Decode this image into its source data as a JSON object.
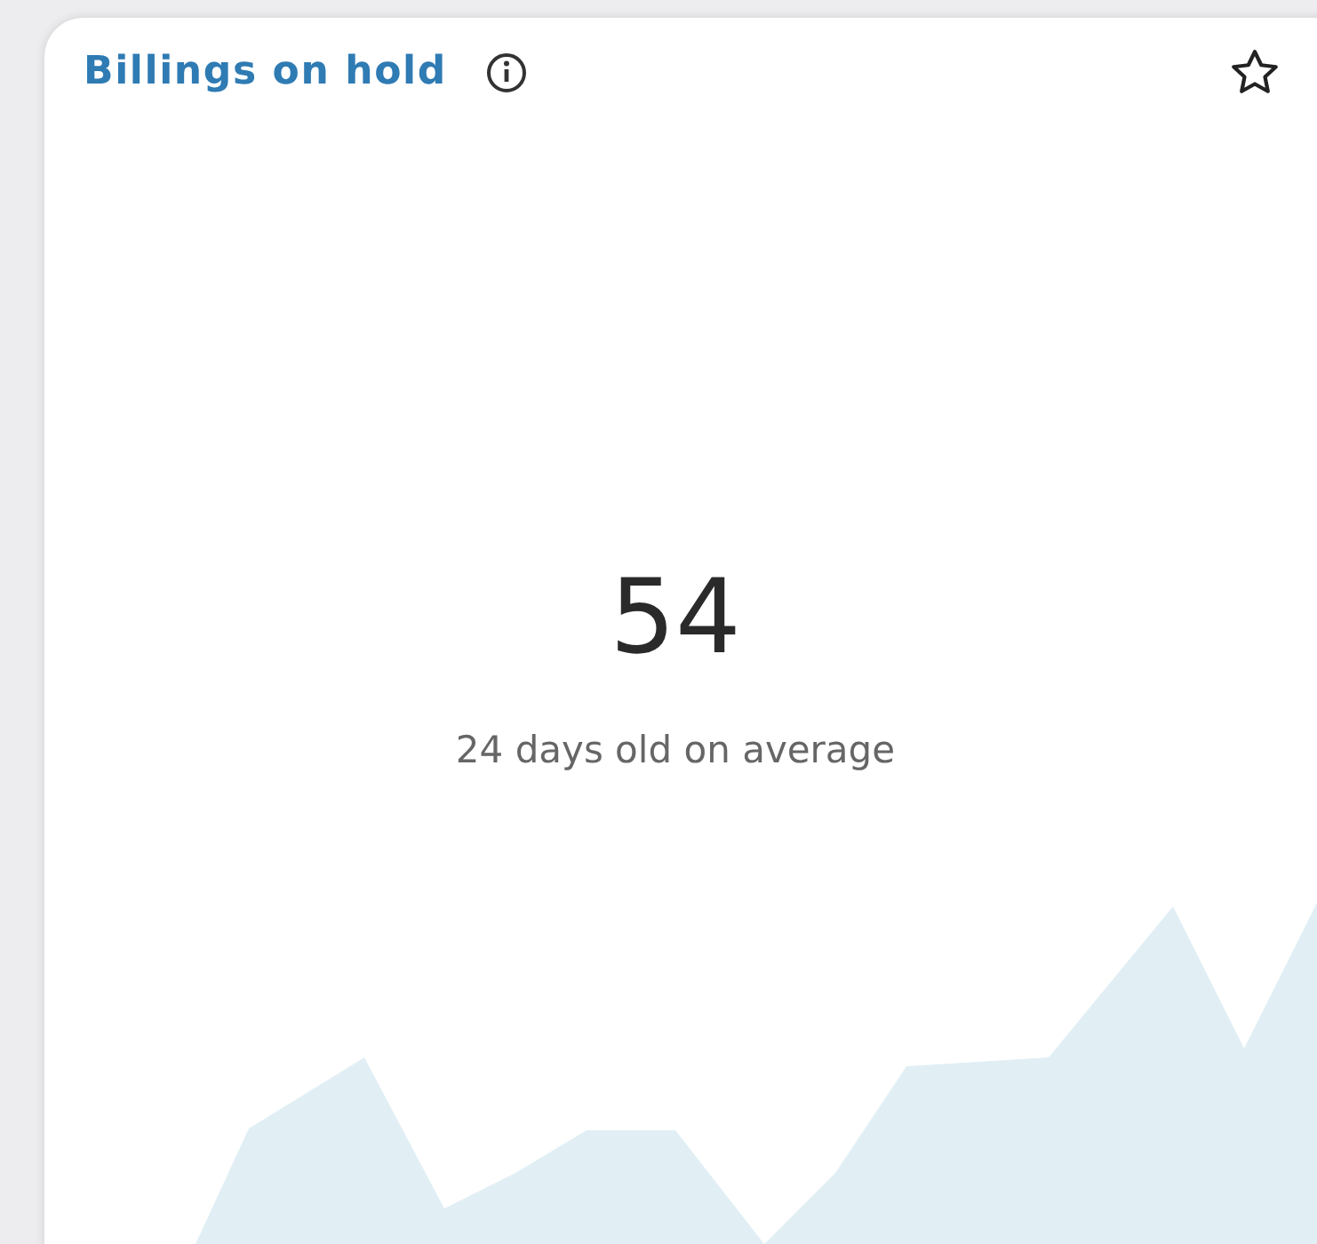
{
  "card": {
    "title": "Billings on hold",
    "favorite": false,
    "value": "54",
    "subtitle": "24 days old on average"
  }
}
